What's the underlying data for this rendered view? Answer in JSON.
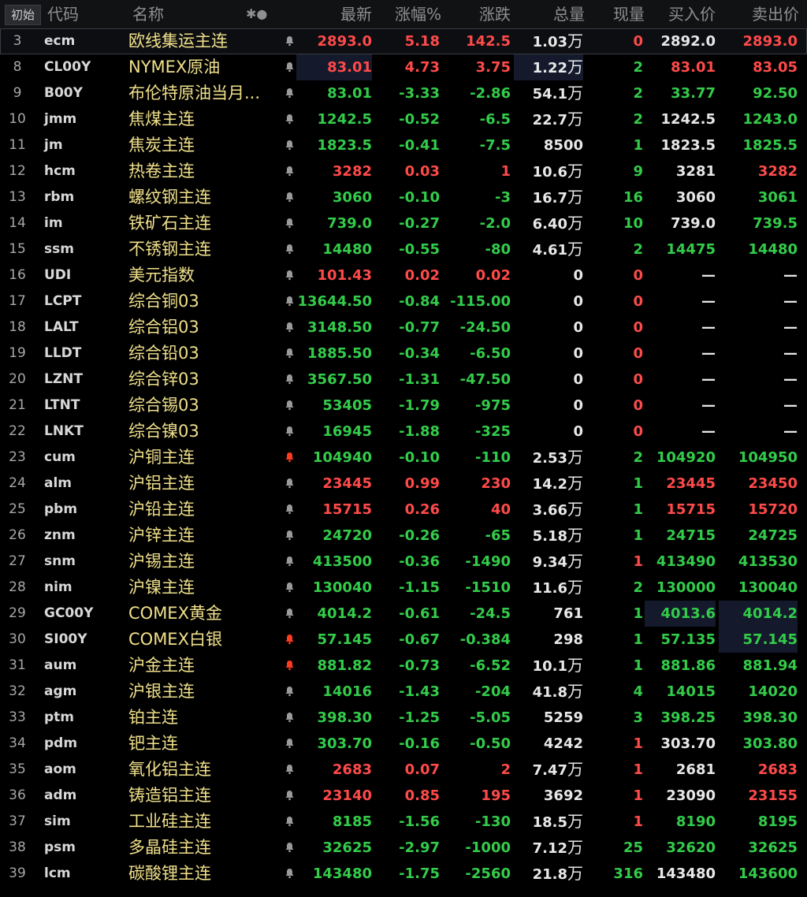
{
  "header": {
    "init_label": "初始",
    "code": "代码",
    "name": "名称",
    "toggle": "✱●",
    "last": "最新",
    "pct": "涨幅%",
    "chg": "涨跌",
    "vol": "总量",
    "cur": "现量",
    "bid": "买入价",
    "ask": "卖出价"
  },
  "colors": {
    "up": "#ff4a4a",
    "down": "#33cc4a",
    "name": "#f0e08a",
    "alert": "#ff3b1f"
  },
  "rows": [
    {
      "idx": "3",
      "code": "ecm",
      "name": "欧线集运主连",
      "last": "2893.0",
      "pct": "5.18",
      "chg": "142.5",
      "vol": "1.03",
      "unit": "万",
      "cur": "0",
      "bid": "2892.0",
      "ask": "2893.0",
      "dir": "up",
      "bell": "normal"
    },
    {
      "idx": "8",
      "code": "CL00Y",
      "name": "NYMEX原油",
      "last": "83.01",
      "pct": "4.73",
      "chg": "3.75",
      "vol": "1.22",
      "unit": "万",
      "cur": "2",
      "bid": "83.01",
      "ask": "83.05",
      "dir": "up",
      "bell": "normal"
    },
    {
      "idx": "9",
      "code": "B00Y",
      "name": "布伦特原油当月...",
      "last": "83.01",
      "pct": "-3.33",
      "chg": "-2.86",
      "vol": "54.1",
      "unit": "万",
      "cur": "2",
      "bid": "33.77",
      "ask": "92.50",
      "dir": "dn",
      "bell": "normal"
    },
    {
      "idx": "10",
      "code": "jmm",
      "name": "焦煤主连",
      "last": "1242.5",
      "pct": "-0.52",
      "chg": "-6.5",
      "vol": "22.7",
      "unit": "万",
      "cur": "2",
      "bid": "1242.5",
      "ask": "1243.0",
      "dir": "dn",
      "bell": "normal"
    },
    {
      "idx": "11",
      "code": "jm",
      "name": "焦炭主连",
      "last": "1823.5",
      "pct": "-0.41",
      "chg": "-7.5",
      "vol": "8500",
      "unit": "",
      "cur": "1",
      "bid": "1823.5",
      "ask": "1825.5",
      "dir": "dn",
      "bell": "normal"
    },
    {
      "idx": "12",
      "code": "hcm",
      "name": "热卷主连",
      "last": "3282",
      "pct": "0.03",
      "chg": "1",
      "vol": "10.6",
      "unit": "万",
      "cur": "9",
      "bid": "3281",
      "ask": "3282",
      "dir": "up",
      "bell": "normal"
    },
    {
      "idx": "13",
      "code": "rbm",
      "name": "螺纹钢主连",
      "last": "3060",
      "pct": "-0.10",
      "chg": "-3",
      "vol": "16.7",
      "unit": "万",
      "cur": "16",
      "bid": "3060",
      "ask": "3061",
      "dir": "dn",
      "bell": "normal"
    },
    {
      "idx": "14",
      "code": "im",
      "name": "铁矿石主连",
      "last": "739.0",
      "pct": "-0.27",
      "chg": "-2.0",
      "vol": "6.40",
      "unit": "万",
      "cur": "10",
      "bid": "739.0",
      "ask": "739.5",
      "dir": "dn",
      "bell": "normal"
    },
    {
      "idx": "15",
      "code": "ssm",
      "name": "不锈钢主连",
      "last": "14480",
      "pct": "-0.55",
      "chg": "-80",
      "vol": "4.61",
      "unit": "万",
      "cur": "2",
      "bid": "14475",
      "ask": "14480",
      "dir": "dn",
      "bell": "normal"
    },
    {
      "idx": "16",
      "code": "UDI",
      "name": "美元指数",
      "last": "101.43",
      "pct": "0.02",
      "chg": "0.02",
      "vol": "0",
      "unit": "",
      "cur": "0",
      "bid": "—",
      "ask": "—",
      "dir": "up",
      "bell": "normal"
    },
    {
      "idx": "17",
      "code": "LCPT",
      "name": "综合铜03",
      "last": "13644.50",
      "pct": "-0.84",
      "chg": "-115.00",
      "vol": "0",
      "unit": "",
      "cur": "0",
      "bid": "—",
      "ask": "—",
      "dir": "dn",
      "bell": "normal"
    },
    {
      "idx": "18",
      "code": "LALT",
      "name": "综合铝03",
      "last": "3148.50",
      "pct": "-0.77",
      "chg": "-24.50",
      "vol": "0",
      "unit": "",
      "cur": "0",
      "bid": "—",
      "ask": "—",
      "dir": "dn",
      "bell": "normal"
    },
    {
      "idx": "19",
      "code": "LLDT",
      "name": "综合铅03",
      "last": "1885.50",
      "pct": "-0.34",
      "chg": "-6.50",
      "vol": "0",
      "unit": "",
      "cur": "0",
      "bid": "—",
      "ask": "—",
      "dir": "dn",
      "bell": "normal"
    },
    {
      "idx": "20",
      "code": "LZNT",
      "name": "综合锌03",
      "last": "3567.50",
      "pct": "-1.31",
      "chg": "-47.50",
      "vol": "0",
      "unit": "",
      "cur": "0",
      "bid": "—",
      "ask": "—",
      "dir": "dn",
      "bell": "normal"
    },
    {
      "idx": "21",
      "code": "LTNT",
      "name": "综合锡03",
      "last": "53405",
      "pct": "-1.79",
      "chg": "-975",
      "vol": "0",
      "unit": "",
      "cur": "0",
      "bid": "—",
      "ask": "—",
      "dir": "dn",
      "bell": "normal"
    },
    {
      "idx": "22",
      "code": "LNKT",
      "name": "综合镍03",
      "last": "16945",
      "pct": "-1.88",
      "chg": "-325",
      "vol": "0",
      "unit": "",
      "cur": "0",
      "bid": "—",
      "ask": "—",
      "dir": "dn",
      "bell": "normal"
    },
    {
      "idx": "23",
      "code": "cum",
      "name": "沪铜主连",
      "last": "104940",
      "pct": "-0.10",
      "chg": "-110",
      "vol": "2.53",
      "unit": "万",
      "cur": "2",
      "bid": "104920",
      "ask": "104950",
      "dir": "dn",
      "bell": "alert"
    },
    {
      "idx": "24",
      "code": "alm",
      "name": "沪铝主连",
      "last": "23445",
      "pct": "0.99",
      "chg": "230",
      "vol": "14.2",
      "unit": "万",
      "cur": "1",
      "bid": "23445",
      "ask": "23450",
      "dir": "up",
      "bell": "normal"
    },
    {
      "idx": "25",
      "code": "pbm",
      "name": "沪铅主连",
      "last": "15715",
      "pct": "0.26",
      "chg": "40",
      "vol": "3.66",
      "unit": "万",
      "cur": "1",
      "bid": "15715",
      "ask": "15720",
      "dir": "up",
      "bell": "normal"
    },
    {
      "idx": "26",
      "code": "znm",
      "name": "沪锌主连",
      "last": "24720",
      "pct": "-0.26",
      "chg": "-65",
      "vol": "5.18",
      "unit": "万",
      "cur": "1",
      "bid": "24715",
      "ask": "24725",
      "dir": "dn",
      "bell": "normal"
    },
    {
      "idx": "27",
      "code": "snm",
      "name": "沪锡主连",
      "last": "413500",
      "pct": "-0.36",
      "chg": "-1490",
      "vol": "9.34",
      "unit": "万",
      "cur": "1",
      "bid": "413490",
      "ask": "413530",
      "dir": "dn",
      "bell": "normal"
    },
    {
      "idx": "28",
      "code": "nim",
      "name": "沪镍主连",
      "last": "130040",
      "pct": "-1.15",
      "chg": "-1510",
      "vol": "11.6",
      "unit": "万",
      "cur": "2",
      "bid": "130000",
      "ask": "130040",
      "dir": "dn",
      "bell": "normal"
    },
    {
      "idx": "29",
      "code": "GC00Y",
      "name": "COMEX黄金",
      "last": "4014.2",
      "pct": "-0.61",
      "chg": "-24.5",
      "vol": "761",
      "unit": "",
      "cur": "1",
      "bid": "4013.6",
      "ask": "4014.2",
      "dir": "dn",
      "bell": "normal"
    },
    {
      "idx": "30",
      "code": "SI00Y",
      "name": "COMEX白银",
      "last": "57.145",
      "pct": "-0.67",
      "chg": "-0.384",
      "vol": "298",
      "unit": "",
      "cur": "1",
      "bid": "57.135",
      "ask": "57.145",
      "dir": "dn",
      "bell": "alert"
    },
    {
      "idx": "31",
      "code": "aum",
      "name": "沪金主连",
      "last": "881.82",
      "pct": "-0.73",
      "chg": "-6.52",
      "vol": "10.1",
      "unit": "万",
      "cur": "1",
      "bid": "881.86",
      "ask": "881.94",
      "dir": "dn",
      "bell": "alert"
    },
    {
      "idx": "32",
      "code": "agm",
      "name": "沪银主连",
      "last": "14016",
      "pct": "-1.43",
      "chg": "-204",
      "vol": "41.8",
      "unit": "万",
      "cur": "4",
      "bid": "14015",
      "ask": "14020",
      "dir": "dn",
      "bell": "normal"
    },
    {
      "idx": "33",
      "code": "ptm",
      "name": "铂主连",
      "last": "398.30",
      "pct": "-1.25",
      "chg": "-5.05",
      "vol": "5259",
      "unit": "",
      "cur": "3",
      "bid": "398.25",
      "ask": "398.30",
      "dir": "dn",
      "bell": "normal"
    },
    {
      "idx": "34",
      "code": "pdm",
      "name": "钯主连",
      "last": "303.70",
      "pct": "-0.16",
      "chg": "-0.50",
      "vol": "4242",
      "unit": "",
      "cur": "1",
      "bid": "303.70",
      "ask": "303.80",
      "dir": "dn",
      "bell": "normal"
    },
    {
      "idx": "35",
      "code": "aom",
      "name": "氧化铝主连",
      "last": "2683",
      "pct": "0.07",
      "chg": "2",
      "vol": "7.47",
      "unit": "万",
      "cur": "1",
      "bid": "2681",
      "ask": "2683",
      "dir": "up",
      "bell": "normal"
    },
    {
      "idx": "36",
      "code": "adm",
      "name": "铸造铝主连",
      "last": "23140",
      "pct": "0.85",
      "chg": "195",
      "vol": "3692",
      "unit": "",
      "cur": "1",
      "bid": "23090",
      "ask": "23155",
      "dir": "up",
      "bell": "normal"
    },
    {
      "idx": "37",
      "code": "sim",
      "name": "工业硅主连",
      "last": "8185",
      "pct": "-1.56",
      "chg": "-130",
      "vol": "18.5",
      "unit": "万",
      "cur": "1",
      "bid": "8190",
      "ask": "8195",
      "dir": "dn",
      "bell": "normal"
    },
    {
      "idx": "38",
      "code": "psm",
      "name": "多晶硅主连",
      "last": "32625",
      "pct": "-2.97",
      "chg": "-1000",
      "vol": "7.12",
      "unit": "万",
      "cur": "25",
      "bid": "32620",
      "ask": "32625",
      "dir": "dn",
      "bell": "normal"
    },
    {
      "idx": "39",
      "code": "lcm",
      "name": "碳酸锂主连",
      "last": "143480",
      "pct": "-1.75",
      "chg": "-2560",
      "vol": "21.8",
      "unit": "万",
      "cur": "316",
      "bid": "143480",
      "ask": "143600",
      "dir": "dn",
      "bell": "normal"
    }
  ]
}
